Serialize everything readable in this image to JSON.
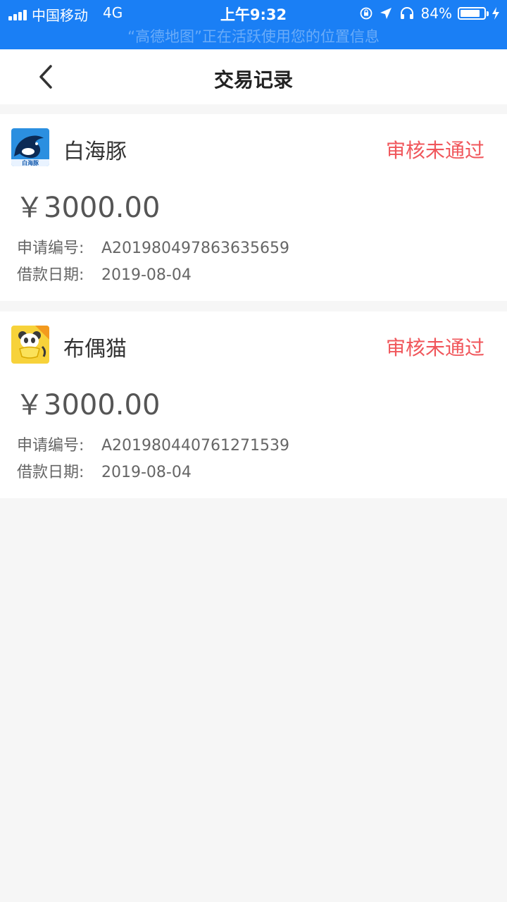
{
  "status_bar": {
    "carrier": "中国移动",
    "network": "4G",
    "time": "上午9:32",
    "battery": "84%",
    "battery_level": 0.84,
    "location_notice": "“高德地图”正在活跃使用您的位置信息"
  },
  "navbar": {
    "title": "交易记录",
    "back_icon": "chevron-left-icon"
  },
  "records": [
    {
      "name": "白海豚",
      "logo_text": "白海豚",
      "status": "审核未通过",
      "amount": "￥3000.00",
      "app_no_label": "申请编号:",
      "app_no": "A201980497863635659",
      "date_label": "借款日期:",
      "date": "2019-08-04"
    },
    {
      "name": "布偶猫",
      "logo_text": "",
      "status": "审核未通过",
      "amount": "￥3000.00",
      "app_no_label": "申请编号:",
      "app_no": "A201980440761271539",
      "date_label": "借款日期:",
      "date": "2019-08-04"
    }
  ],
  "colors": {
    "status_bar_bg": "#1a7ff5",
    "status_rejected": "#f0565b",
    "page_bg": "#f6f6f6"
  }
}
